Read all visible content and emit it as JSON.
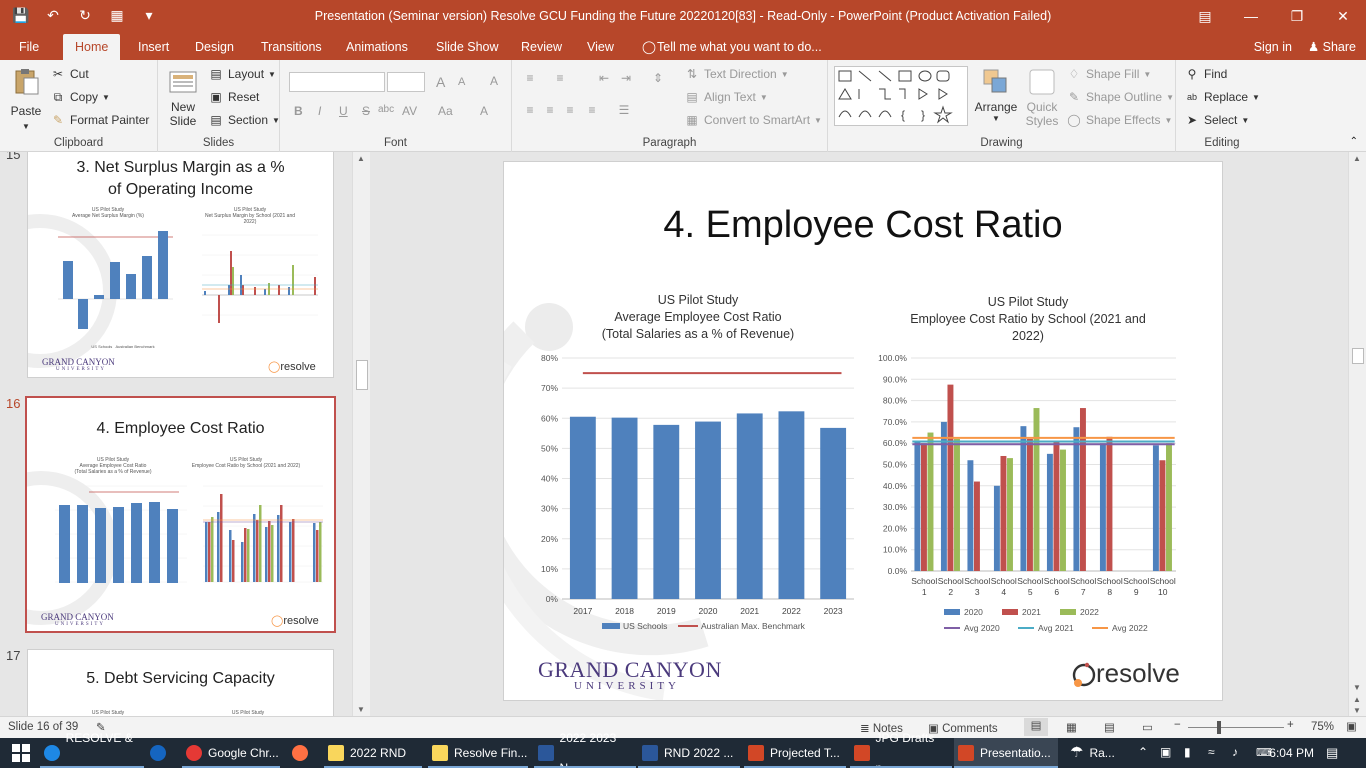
{
  "window": {
    "title": "Presentation (Seminar version) Resolve GCU Funding the Future 20220120[83]  -  Read-Only  -  PowerPoint (Product Activation Failed)"
  },
  "tabs": {
    "file": "File",
    "home": "Home",
    "insert": "Insert",
    "design": "Design",
    "transitions": "Transitions",
    "animations": "Animations",
    "slideshow": "Slide Show",
    "review": "Review",
    "view": "View",
    "tellme": "Tell me what you want to do...",
    "signin": "Sign in",
    "share": "Share"
  },
  "ribbon": {
    "clipboard": {
      "paste": "Paste",
      "cut": "Cut",
      "copy": "Copy",
      "format_painter": "Format Painter",
      "label": "Clipboard"
    },
    "slides": {
      "new_slide_1": "New",
      "new_slide_2": "Slide",
      "layout": "Layout",
      "reset": "Reset",
      "section": "Section",
      "label": "Slides"
    },
    "font": {
      "label": "Font",
      "bold": "B",
      "italic": "I",
      "underline": "U",
      "strike": "S",
      "shadow": "abc",
      "spacing": "AV",
      "case": "Aa",
      "grow": "A",
      "shrink": "A",
      "clear": "A",
      "color": "A"
    },
    "paragraph": {
      "label": "Paragraph",
      "text_direction": "Text Direction",
      "align_text": "Align Text",
      "smartart": "Convert to SmartArt"
    },
    "drawing": {
      "label": "Drawing",
      "arrange": "Arrange",
      "quick_styles_1": "Quick",
      "quick_styles_2": "Styles",
      "shape_fill": "Shape Fill",
      "shape_outline": "Shape Outline",
      "shape_effects": "Shape Effects"
    },
    "editing": {
      "label": "Editing",
      "find": "Find",
      "replace": "Replace",
      "select": "Select"
    }
  },
  "thumbnails": [
    {
      "number": "15",
      "title": "3. Net Surplus Margin as a % of Operating Income",
      "left_chart": {
        "title_1": "US Pilot Study",
        "title_2": "Average Net Surplus Margin (%)",
        "legend": [
          "US Schools",
          "Australian Benchmark"
        ]
      },
      "right_chart": {
        "title_1": "US Pilot Study",
        "title_2": "Net Surplus Margin by School (2021 and 2022)"
      },
      "logo_1": "GRAND CANYON",
      "logo_2": "UNIVERSITY",
      "brand": "resolve"
    },
    {
      "number": "16",
      "title": "4. Employee Cost Ratio",
      "left_chart": {
        "title_1": "US Pilot Study",
        "title_2": "Average Employee Cost Ratio",
        "title_3": "(Total Salaries as a % of Revenue)"
      },
      "right_chart": {
        "title_1": "US Pilot Study",
        "title_2": "Employee Cost Ratio by School (2021 and 2022)"
      },
      "logo_1": "GRAND CANYON",
      "logo_2": "UNIVERSITY",
      "brand": "resolve"
    },
    {
      "number": "17",
      "title": "5. Debt Servicing Capacity",
      "left_chart": {
        "title_1": "US Pilot Study"
      },
      "right_chart": {
        "title_1": "US Pilot Study"
      }
    }
  ],
  "slide": {
    "title": "4. Employee Cost Ratio",
    "logo_1": "GRAND CANYON",
    "logo_2": "UNIVERSITY",
    "brand": "resolve"
  },
  "chart_data": [
    {
      "type": "bar",
      "title": "US Pilot Study\nAverage Employee Cost Ratio\n(Total Salaries as a % of Revenue)",
      "title_lines": [
        "US Pilot Study",
        "Average Employee Cost Ratio",
        "(Total Salaries as a % of Revenue)"
      ],
      "categories": [
        "2017",
        "2018",
        "2019",
        "2020",
        "2021",
        "2022",
        "2023"
      ],
      "series": [
        {
          "name": "US Schools",
          "type": "bar",
          "color": "#4f81bd",
          "values": [
            60.5,
            60.2,
            57.8,
            58.9,
            61.6,
            62.3,
            56.8
          ]
        },
        {
          "name": "Australian Max. Benchmark",
          "type": "line",
          "color": "#c0504d",
          "values": [
            75,
            75,
            75,
            75,
            75,
            75,
            75
          ]
        }
      ],
      "y_ticks": [
        "0%",
        "10%",
        "20%",
        "30%",
        "40%",
        "50%",
        "60%",
        "70%",
        "80%"
      ],
      "ylim": [
        0,
        80
      ],
      "grid": true,
      "legend": "bottom"
    },
    {
      "type": "bar",
      "title": "US Pilot Study\nEmployee Cost Ratio by School (2021 and 2022)",
      "title_lines": [
        "US Pilot Study",
        "Employee Cost Ratio by School (2021 and",
        "2022)"
      ],
      "categories": [
        [
          "School",
          "1"
        ],
        [
          "School",
          "2"
        ],
        [
          "School",
          "3"
        ],
        [
          "School",
          "4"
        ],
        [
          "School",
          "5"
        ],
        [
          "School",
          "6"
        ],
        [
          "School",
          "7"
        ],
        [
          "School",
          "8"
        ],
        [
          "School",
          "9"
        ],
        [
          "School",
          "10"
        ]
      ],
      "series": [
        {
          "name": "2020",
          "type": "bar",
          "color": "#4f81bd",
          "values": [
            61,
            70,
            52,
            40,
            68,
            55,
            67.5,
            60,
            0,
            59
          ]
        },
        {
          "name": "2021",
          "type": "bar",
          "color": "#c0504d",
          "values": [
            60,
            87.5,
            42,
            54,
            62,
            61,
            76.5,
            63,
            0,
            52
          ]
        },
        {
          "name": "2022",
          "type": "bar",
          "color": "#9bbb59",
          "values": [
            65,
            62,
            0,
            53,
            76.5,
            57,
            0,
            0,
            0,
            60
          ]
        },
        {
          "name": "Avg 2020",
          "type": "line",
          "color": "#7f5fa6",
          "values": [
            59.5,
            59.5,
            59.5,
            59.5,
            59.5,
            59.5,
            59.5,
            59.5,
            59.5,
            59.5
          ]
        },
        {
          "name": "Avg 2021",
          "type": "line",
          "color": "#4bacc6",
          "values": [
            60.8,
            60.8,
            60.8,
            60.8,
            60.8,
            60.8,
            60.8,
            60.8,
            60.8,
            60.8
          ]
        },
        {
          "name": "Avg 2022",
          "type": "line",
          "color": "#f79646",
          "values": [
            62.5,
            62.5,
            62.5,
            62.5,
            62.5,
            62.5,
            62.5,
            62.5,
            62.5,
            62.5
          ]
        }
      ],
      "y_ticks": [
        "0.0%",
        "10.0%",
        "20.0%",
        "30.0%",
        "40.0%",
        "50.0%",
        "60.0%",
        "70.0%",
        "80.0%",
        "90.0%",
        "100.0%"
      ],
      "ylim": [
        0,
        100
      ],
      "grid": true,
      "legend": "bottom"
    }
  ],
  "status": {
    "slide_info": "Slide 16 of 39",
    "notes": "Notes",
    "comments": "Comments",
    "zoom": "75%"
  },
  "taskbar": {
    "items": [
      {
        "label": "RESOLVE & ...",
        "color": "#1e88e5"
      },
      {
        "label": "",
        "color": "#1565c0"
      },
      {
        "label": "Google Chr...",
        "color": "#e53935"
      },
      {
        "label": "",
        "color": "#ff7043"
      },
      {
        "label": "2022 RND",
        "color": "#f9d65c"
      },
      {
        "label": "Resolve Fin...",
        "color": "#f9d65c"
      },
      {
        "label": "2022 2023 N...",
        "color": "#2b579a"
      },
      {
        "label": "RND 2022 ...",
        "color": "#2b579a"
      },
      {
        "label": "Projected T...",
        "color": "#d24726"
      },
      {
        "label": "JPG Drafts p...",
        "color": "#d24726"
      },
      {
        "label": "Presentatio...",
        "color": "#d24726"
      }
    ],
    "weather": "Ra...",
    "time": "6:04 PM"
  },
  "colors": {
    "accent": "#b7472a",
    "selected_thumb": "#c0504d",
    "logo_purple": "#4b3a7c"
  }
}
